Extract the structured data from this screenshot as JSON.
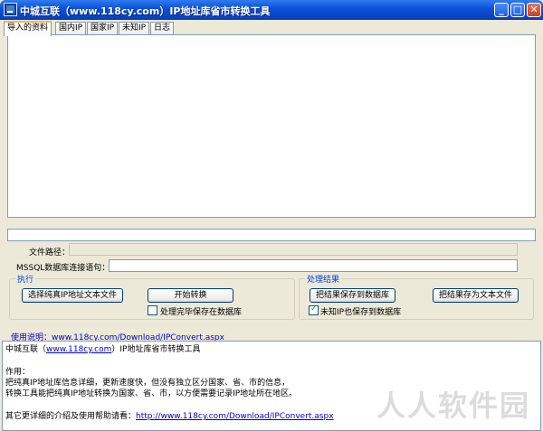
{
  "window": {
    "title": "中城互联（www.118cy.com）IP地址库省市转换工具",
    "buttons": {
      "minimize": "_",
      "maximize": "□",
      "close": "✕"
    }
  },
  "tabs": [
    {
      "label": "导入的资料",
      "active": true
    },
    {
      "label": "国内IP"
    },
    {
      "label": "国家IP"
    },
    {
      "label": "未知IP"
    },
    {
      "label": "日志"
    }
  ],
  "form": {
    "file_path_label": "文件路径：",
    "file_path_value": "",
    "mssql_label": "MSSQL数据库连接语句：",
    "mssql_value": ""
  },
  "execute_group": {
    "title": "执行",
    "select_file_button": "选择纯真IP地址文本文件",
    "start_button": "开始转换",
    "save_after_label": "处理完毕保存在数据库",
    "save_after_checked": false
  },
  "result_group": {
    "title": "处理结果",
    "save_db_button": "把结果保存到数据库",
    "save_text_button": "把结果存为文本文件",
    "unknown_ip_label": "未知IP也保存到数据库",
    "unknown_ip_checked": true
  },
  "help": {
    "prefix": "使用说明：",
    "link": "www.118cy.com/Download/IPConvert.aspx"
  },
  "info": {
    "line1_prefix": "中城互联（",
    "line1_link": "www.118cy.com",
    "line1_suffix": "）IP地址库省市转换工具",
    "purpose_heading": "作用：",
    "purpose_line1": "把纯真IP地址库信息详细，更新速度快，但没有独立区分国家、省、市的信息，",
    "purpose_line2": "转换工具能把纯真IP地址转换为国家、省、市，以方便需要记录IP地址所在地区。",
    "more_prefix": "其它更详细的介绍及使用帮助请看：",
    "more_link": "http://www.118cy.com/Download/IPConvert.aspx"
  },
  "watermark": "人人软件园"
}
